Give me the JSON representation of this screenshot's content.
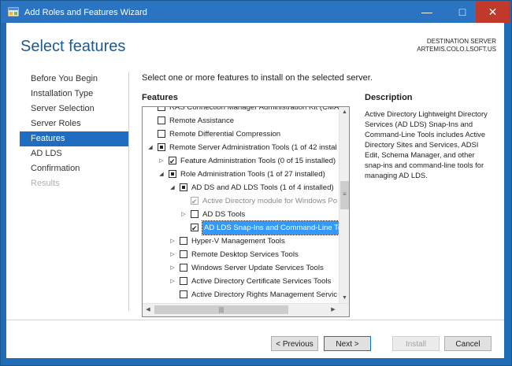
{
  "window": {
    "title": "Add Roles and Features Wizard",
    "minimize_glyph": "—",
    "maximize_glyph": "□",
    "close_glyph": "✕"
  },
  "header": {
    "page_title": "Select features",
    "destination_label": "DESTINATION SERVER",
    "destination_server": "ARTEMIS.COLO.LSOFT.US"
  },
  "nav": {
    "items": [
      {
        "label": "Before You Begin",
        "state": "normal"
      },
      {
        "label": "Installation Type",
        "state": "normal"
      },
      {
        "label": "Server Selection",
        "state": "normal"
      },
      {
        "label": "Server Roles",
        "state": "normal"
      },
      {
        "label": "Features",
        "state": "active"
      },
      {
        "label": "AD LDS",
        "state": "normal"
      },
      {
        "label": "Confirmation",
        "state": "normal"
      },
      {
        "label": "Results",
        "state": "disabled"
      }
    ]
  },
  "main": {
    "instruction": "Select one or more features to install on the selected server.",
    "features_label": "Features",
    "description_label": "Description",
    "description_text": "Active Directory Lightweight Directory Services (AD LDS) Snap-Ins and Command-Line Tools includes Active Directory Sites and Services, ADSI Edit, Schema Manager, and other snap-ins and command-line tools for managing AD LDS."
  },
  "tree": {
    "rows": [
      {
        "label": "RAS Connection Manager Administration Kit (CMA",
        "level": 0,
        "expander": "",
        "check": "none"
      },
      {
        "label": "Remote Assistance",
        "level": 0,
        "expander": "",
        "check": "none"
      },
      {
        "label": "Remote Differential Compression",
        "level": 0,
        "expander": "",
        "check": "none"
      },
      {
        "label": "Remote Server Administration Tools (1 of 42 instal",
        "level": 0,
        "expander": "◢",
        "check": "partial"
      },
      {
        "label": "Feature Administration Tools (0 of 15 installed)",
        "level": 1,
        "expander": "▷",
        "check": "checked"
      },
      {
        "label": "Role Administration Tools (1 of 27 installed)",
        "level": 1,
        "expander": "◢",
        "check": "partial"
      },
      {
        "label": "AD DS and AD LDS Tools (1 of 4 installed)",
        "level": 2,
        "expander": "◢",
        "check": "partial"
      },
      {
        "label": "Active Directory module for Windows Po",
        "level": 3,
        "expander": "",
        "check": "disabled-checked",
        "dim": true
      },
      {
        "label": "AD DS Tools",
        "level": 3,
        "expander": "▷",
        "check": "none"
      },
      {
        "label": "AD LDS Snap-Ins and Command-Line To",
        "level": 3,
        "expander": "",
        "check": "checked",
        "selected": true
      },
      {
        "label": "Hyper-V Management Tools",
        "level": 2,
        "expander": "▷",
        "check": "none"
      },
      {
        "label": "Remote Desktop Services Tools",
        "level": 2,
        "expander": "▷",
        "check": "none"
      },
      {
        "label": "Windows Server Update Services Tools",
        "level": 2,
        "expander": "▷",
        "check": "none"
      },
      {
        "label": "Active Directory Certificate Services Tools",
        "level": 2,
        "expander": "▷",
        "check": "none"
      },
      {
        "label": "Active Directory Rights Management Servic",
        "level": 2,
        "expander": "",
        "check": "none"
      }
    ],
    "scroll_up": "▲",
    "scroll_down": "▼",
    "scroll_left": "◀",
    "scroll_right": "▶",
    "vgrip": "≡",
    "hgrip": "|||"
  },
  "footer": {
    "previous": "< Previous",
    "next": "Next >",
    "install": "Install",
    "cancel": "Cancel"
  },
  "colors": {
    "title_bar": "#2a74c1",
    "accent": "#1f6cc0",
    "page_title": "#1c5a93",
    "selection": "#3399ff"
  },
  "icons": [
    "app-wizard-icon",
    "minimize-icon",
    "maximize-icon",
    "close-icon"
  ]
}
